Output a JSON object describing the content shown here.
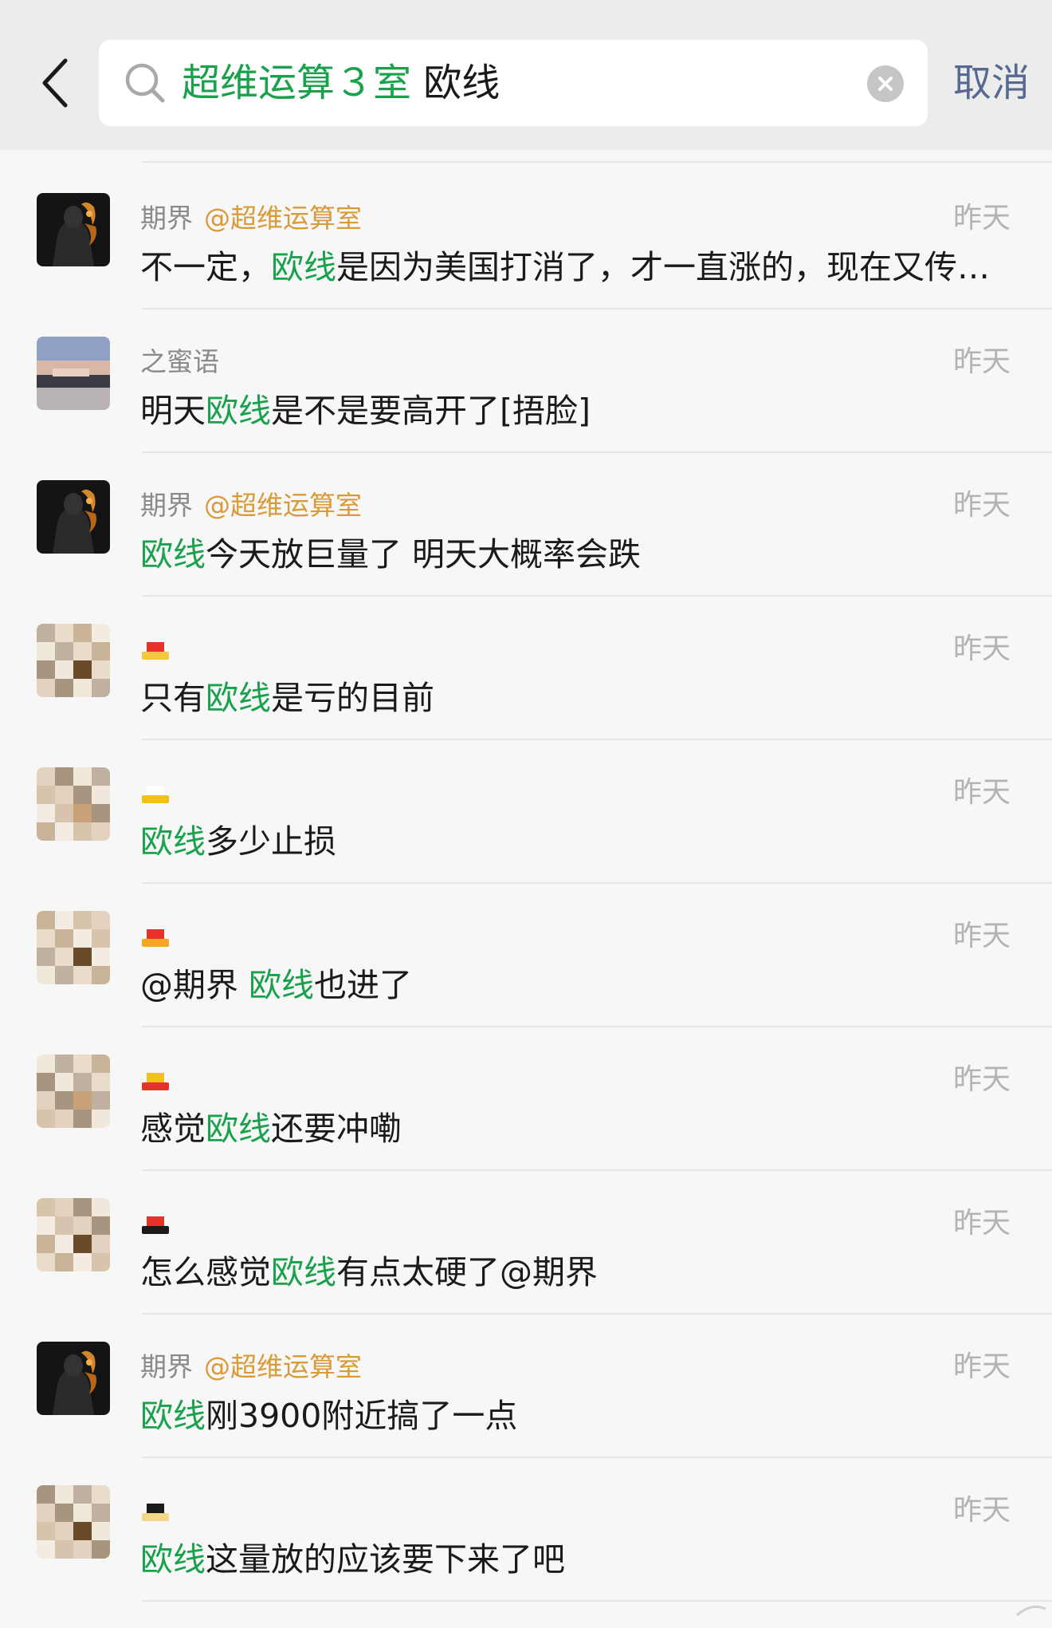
{
  "search": {
    "tag_text": "超维运算３室",
    "query_text": "欧线",
    "cancel_label": "取消"
  },
  "icons": {
    "back": "chevron-left-icon",
    "search": "search-icon",
    "clear": "clear-circle-icon"
  },
  "colors": {
    "highlight": "#19a14c",
    "mention": "#d99a3a",
    "cancel": "#566a91"
  },
  "results": [
    {
      "name": "期界",
      "mention": "@超维运算室",
      "time": "昨天",
      "msg_before": "不一定，",
      "msg_keyword": "欧线",
      "msg_after": "是因为美国打消了，才一直涨的，现在又传…"
    },
    {
      "name": "之蜜语",
      "mention": "",
      "time": "昨天",
      "msg_before": "明天",
      "msg_keyword": "欧线",
      "msg_after": "是不是要高开了[捂脸]"
    },
    {
      "name": "期界",
      "mention": "@超维运算室",
      "time": "昨天",
      "msg_before": "",
      "msg_keyword": "欧线",
      "msg_after": "今天放巨量了 明天大概率会跌"
    },
    {
      "name": "",
      "mention": "",
      "time": "昨天",
      "msg_before": "只有",
      "msg_keyword": "欧线",
      "msg_after": "是亏的目前"
    },
    {
      "name": "",
      "mention": "",
      "time": "昨天",
      "msg_before": "",
      "msg_keyword": "欧线",
      "msg_after": "多少止损"
    },
    {
      "name": "",
      "mention": "",
      "time": "昨天",
      "msg_before": "@期界 ",
      "msg_keyword": "欧线",
      "msg_after": "也进了"
    },
    {
      "name": "",
      "mention": "",
      "time": "昨天",
      "msg_before": "感觉",
      "msg_keyword": "欧线",
      "msg_after": "还要冲嘞"
    },
    {
      "name": "",
      "mention": "",
      "time": "昨天",
      "msg_before": "怎么感觉",
      "msg_keyword": "欧线",
      "msg_after": "有点太硬了@期界"
    },
    {
      "name": "期界",
      "mention": "@超维运算室",
      "time": "昨天",
      "msg_before": "",
      "msg_keyword": "欧线",
      "msg_after": "刚3900附近搞了一点"
    },
    {
      "name": "",
      "mention": "",
      "time": "昨天",
      "msg_before": "",
      "msg_keyword": "欧线",
      "msg_after": "这量放的应该要下来了吧"
    }
  ]
}
